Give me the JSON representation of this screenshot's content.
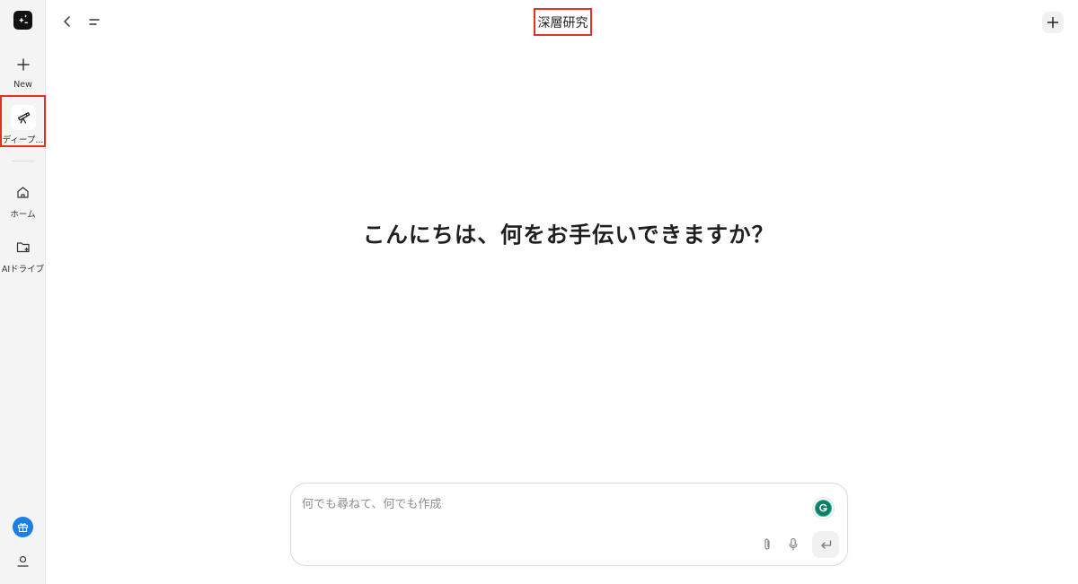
{
  "sidebar": {
    "logo_icon": "sparkle-board-icon",
    "items": [
      {
        "id": "new",
        "label": "New",
        "icon": "plus-icon"
      },
      {
        "id": "deep",
        "label": "ディープ...",
        "icon": "telescope-icon"
      },
      {
        "id": "home",
        "label": "ホーム",
        "icon": "home-icon"
      },
      {
        "id": "drive",
        "label": "AIドライブ",
        "icon": "folder-plus-icon"
      }
    ],
    "bottom": {
      "gift_icon": "gift-icon",
      "user_icon": "user-icon",
      "gift_color": "#1a7fe6"
    }
  },
  "header": {
    "title": "深層研究",
    "back_icon": "chevron-left-icon",
    "menu_icon": "menu-icon",
    "new_icon": "plus-icon"
  },
  "main": {
    "greeting": "こんにちは、何をお手伝いできますか？"
  },
  "composer": {
    "placeholder": "何でも尋ねて、何でも作成",
    "value": "",
    "attach_icon": "paperclip-icon",
    "mic_icon": "microphone-icon",
    "send_icon": "enter-icon",
    "grammarly_icon": "grammarly-icon"
  },
  "colors": {
    "highlight": "#e0341e",
    "accent": "#1a7fe6"
  }
}
